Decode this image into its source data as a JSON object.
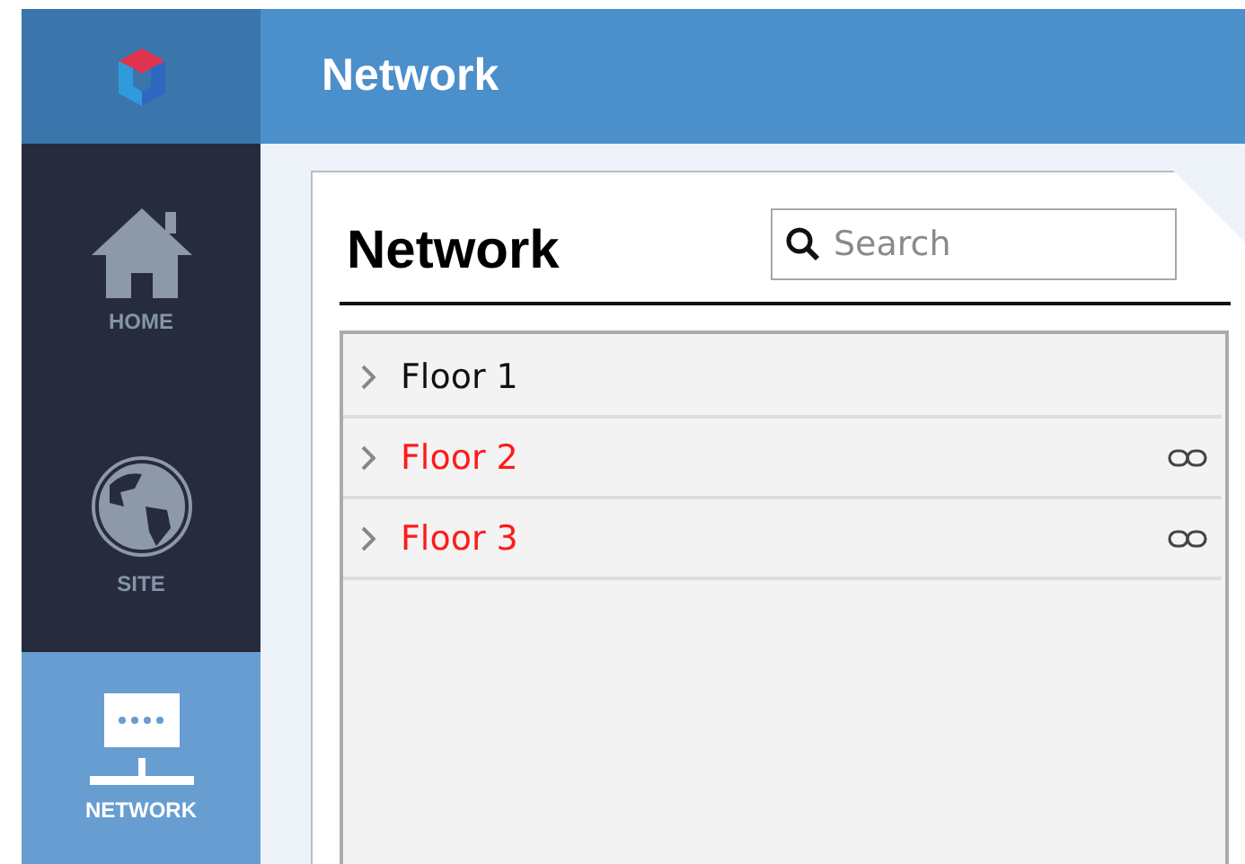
{
  "header": {
    "title": "Network"
  },
  "sidebar": {
    "items": [
      {
        "kind": "home",
        "label": "HOME",
        "selected": false
      },
      {
        "kind": "site",
        "label": "SITE",
        "selected": false
      },
      {
        "kind": "network",
        "label": "NETWORK",
        "selected": true
      }
    ]
  },
  "panel": {
    "title": "Network",
    "search": {
      "placeholder": "Search"
    },
    "rows": [
      {
        "label": "Floor 1",
        "linked": false
      },
      {
        "label": "Floor 2",
        "linked": true
      },
      {
        "label": "Floor 3",
        "linked": true
      }
    ]
  }
}
